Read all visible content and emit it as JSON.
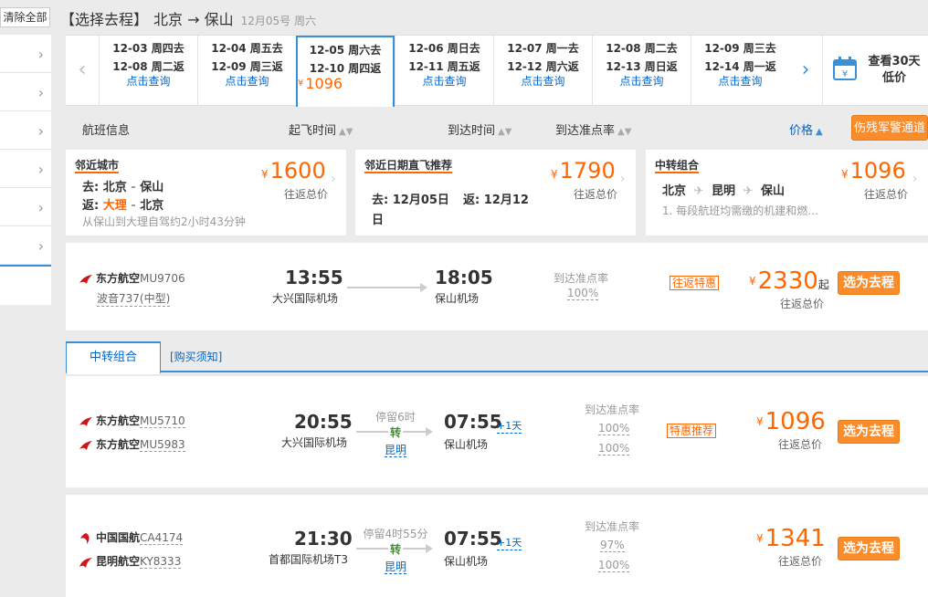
{
  "sidebar": {
    "clear_label": "清除全部",
    "rows": 6
  },
  "header": {
    "bracket_title": "【选择去程】",
    "route": "北京 → 保山",
    "date": "12月05号 周六"
  },
  "datebar": {
    "cells": [
      {
        "out": "12-03 周四去",
        "ret": "12-08 周二返",
        "action": "点击查询"
      },
      {
        "out": "12-04 周五去",
        "ret": "12-09 周三返",
        "action": "点击查询"
      },
      {
        "out": "12-05 周六去",
        "ret": "12-10 周四返",
        "price_symbol": "¥",
        "price": "1096",
        "active": true
      },
      {
        "out": "12-06 周日去",
        "ret": "12-11 周五返",
        "action": "点击查询"
      },
      {
        "out": "12-07 周一去",
        "ret": "12-12 周六返",
        "action": "点击查询"
      },
      {
        "out": "12-08 周二去",
        "ret": "12-13 周日返",
        "action": "点击查询"
      },
      {
        "out": "12-09 周三去",
        "ret": "12-14 周一返",
        "action": "点击查询"
      }
    ],
    "calendar_label_1": "查看30天",
    "calendar_label_2": "低价"
  },
  "sortbar": {
    "flight_info": "航班信息",
    "depart_time": "起飞时间",
    "arrive_time": "到达时间",
    "ontime": "到达准点率",
    "price": "价格",
    "army_button": "伤残军警通道"
  },
  "recs": {
    "nearby": {
      "title": "邻近城市",
      "price_symbol": "¥",
      "price": "1600",
      "sub": "往返总价",
      "go_label": "去:",
      "go_from": "北京",
      "go_to": "保山",
      "ret_label": "返:",
      "ret_from": "大理",
      "ret_to": "北京",
      "sep": "-",
      "hint": "从保山到大理自驾约2小时43分钟"
    },
    "nearby_date": {
      "title": "邻近日期直飞推荐",
      "price_symbol": "¥",
      "price": "1790",
      "sub": "往返总价",
      "go": "去: 12月05日",
      "ret": "返: 12月12",
      "ret2": "日"
    },
    "transfer": {
      "title": "中转组合",
      "price_symbol": "¥",
      "price": "1096",
      "sub": "往返总价",
      "c1": "北京",
      "c2": "昆明",
      "c3": "保山",
      "hint": "1. 每段航班均需缴的机建和燃…"
    }
  },
  "flights": {
    "direct": {
      "airline": "东方航空",
      "flight_no": "MU9706",
      "model": "波音737(中型)",
      "dep_time": "13:55",
      "dep_airport": "大兴国际机场",
      "arr_time": "18:05",
      "arr_airport": "保山机场",
      "ontime_label": "到达准点率",
      "ontime": "100%",
      "tag": "往返特惠",
      "price_symbol": "¥",
      "price": "2330",
      "qi": "起",
      "sub": "往返总价",
      "button": "选为去程"
    },
    "tabs": {
      "active": "中转组合",
      "link": "[购买须知]"
    },
    "t1": {
      "airline1": "东方航空",
      "fno1": "MU5710",
      "airline2": "东方航空",
      "fno2": "MU5983",
      "dep_time": "20:55",
      "dep_airport": "大兴国际机场",
      "stay": "停留6时",
      "zhuan": "转",
      "city": "昆明",
      "arr_time": "07:55",
      "plus": "+1天",
      "arr_airport": "保山机场",
      "ontime_label": "到达准点率",
      "ontime1": "100%",
      "ontime2": "100%",
      "tag": "特惠推荐",
      "price_symbol": "¥",
      "price": "1096",
      "sub": "往返总价",
      "button": "选为去程"
    },
    "t2": {
      "airline1": "中国国航",
      "fno1": "CA4174",
      "airline2": "昆明航空",
      "fno2": "KY8333",
      "dep_time": "21:30",
      "dep_airport": "首都国际机场T3",
      "stay": "停留4时55分",
      "zhuan": "转",
      "city": "昆明",
      "arr_time": "07:55",
      "plus": "+1天",
      "arr_airport": "保山机场",
      "ontime_label": "到达准点率",
      "ontime1": "97%",
      "ontime2": "100%",
      "price_symbol": "¥",
      "price": "1341",
      "sub": "往返总价",
      "button": "选为去程"
    }
  },
  "colors": {
    "accent_blue": "#3a8fd9",
    "price_orange": "#ff6600",
    "button_orange": "#fb8c2a",
    "eastern_red": "#c8161d",
    "airchina_red": "#d4151c"
  }
}
